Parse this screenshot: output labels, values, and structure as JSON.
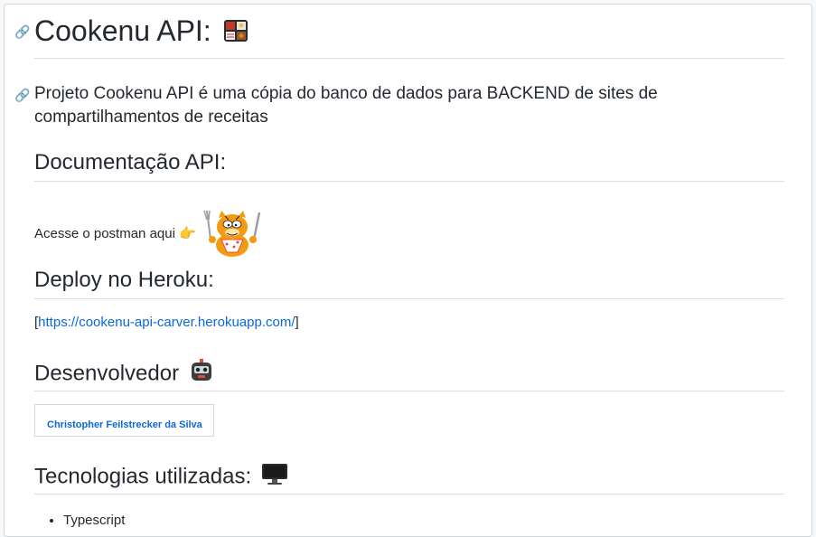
{
  "title": "Cookenu API:",
  "intro": "Projeto Cookenu API é uma cópia do banco de dados para BACKEND de sites de compartilhamentos de receitas",
  "sections": {
    "docs": {
      "heading": "Documentação API:",
      "text": "Acesse o postman aqui",
      "pointer": "👉"
    },
    "deploy": {
      "heading": "Deploy no Heroku:",
      "bracket_open": "[",
      "url": "https://cookenu-api-carver.herokuapp.com/",
      "bracket_close": "]"
    },
    "developer": {
      "heading": "Desenvolvedor",
      "name": "Christopher Feilstrecker da Silva"
    },
    "tech": {
      "heading": "Tecnologias utilizadas:",
      "items": [
        "Typescript"
      ]
    }
  },
  "icons": {
    "title": "bento-box-icon",
    "developer": "robot-icon",
    "tech": "desktop-computer-icon",
    "docs_image": "garfield-eating-image"
  },
  "colors": {
    "link": "#0969da",
    "text": "#24292f",
    "border": "#d0d7de"
  }
}
